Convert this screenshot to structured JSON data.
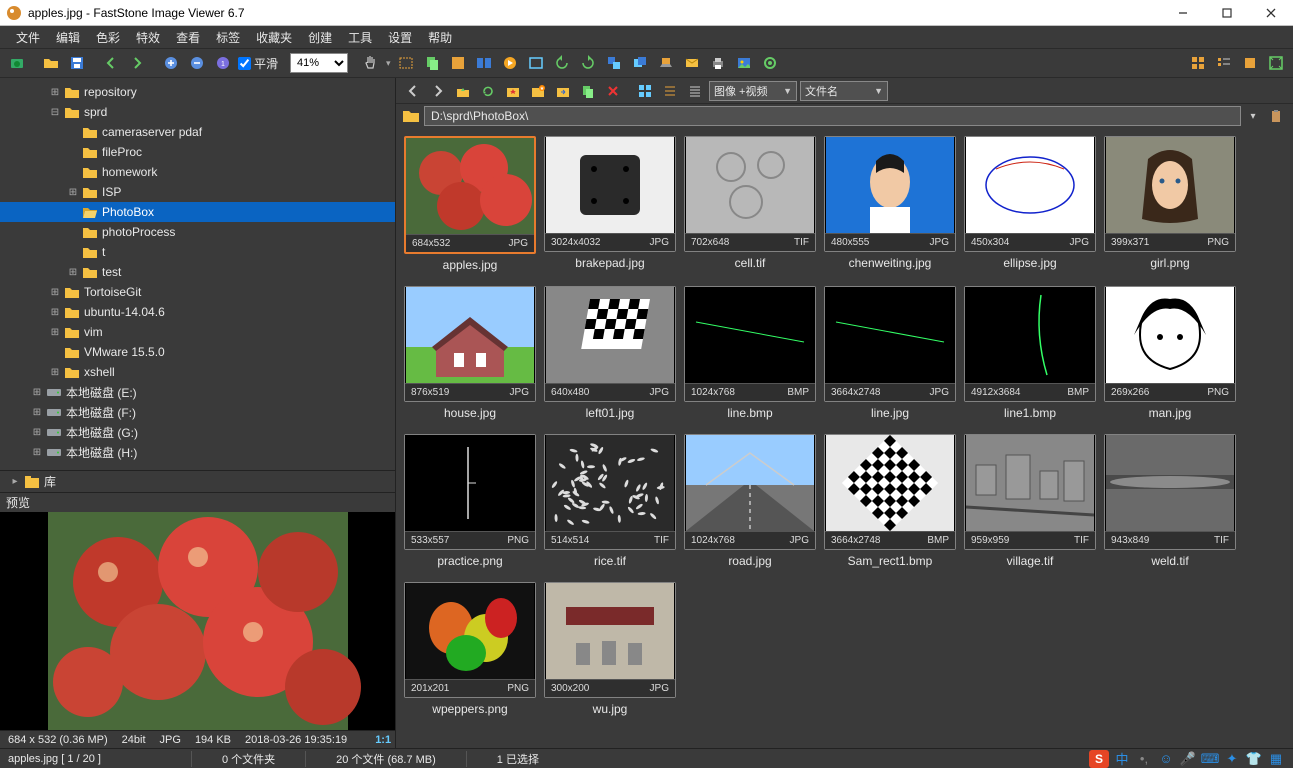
{
  "window": {
    "title": "apples.jpg  -  FastStone Image Viewer 6.7"
  },
  "menu": [
    "文件",
    "编辑",
    "色彩",
    "特效",
    "查看",
    "标签",
    "收藏夹",
    "创建",
    "工具",
    "设置",
    "帮助"
  ],
  "toolbar1": {
    "smooth_label": "平滑",
    "zoom_value": "41%"
  },
  "toolbar2": {
    "filter_label": "图像 +视频",
    "sort_label": "文件名"
  },
  "pathbar": {
    "path": "D:\\sprd\\PhotoBox\\"
  },
  "tree": [
    {
      "indent": 2,
      "twisty": "+",
      "icon": "folder",
      "label": "repository"
    },
    {
      "indent": 2,
      "twisty": "-",
      "icon": "folder",
      "label": "sprd"
    },
    {
      "indent": 3,
      "twisty": "",
      "icon": "folder",
      "label": "cameraserver pdaf"
    },
    {
      "indent": 3,
      "twisty": "",
      "icon": "folder",
      "label": "fileProc"
    },
    {
      "indent": 3,
      "twisty": "",
      "icon": "folder",
      "label": "homework"
    },
    {
      "indent": 3,
      "twisty": "+",
      "icon": "folder",
      "label": "ISP"
    },
    {
      "indent": 3,
      "twisty": "",
      "icon": "folder-open",
      "label": "PhotoBox",
      "selected": true
    },
    {
      "indent": 3,
      "twisty": "",
      "icon": "folder",
      "label": "photoProcess"
    },
    {
      "indent": 3,
      "twisty": "",
      "icon": "folder",
      "label": "t"
    },
    {
      "indent": 3,
      "twisty": "+",
      "icon": "folder",
      "label": "test"
    },
    {
      "indent": 2,
      "twisty": "+",
      "icon": "folder",
      "label": "TortoiseGit"
    },
    {
      "indent": 2,
      "twisty": "+",
      "icon": "folder",
      "label": "ubuntu-14.04.6"
    },
    {
      "indent": 2,
      "twisty": "+",
      "icon": "folder",
      "label": "vim"
    },
    {
      "indent": 2,
      "twisty": "",
      "icon": "folder",
      "label": "VMware 15.5.0"
    },
    {
      "indent": 2,
      "twisty": "+",
      "icon": "folder",
      "label": "xshell"
    },
    {
      "indent": 1,
      "twisty": "+",
      "icon": "drive",
      "label": "本地磁盘 (E:)"
    },
    {
      "indent": 1,
      "twisty": "+",
      "icon": "drive",
      "label": "本地磁盘 (F:)"
    },
    {
      "indent": 1,
      "twisty": "+",
      "icon": "drive",
      "label": "本地磁盘 (G:)"
    },
    {
      "indent": 1,
      "twisty": "+",
      "icon": "drive",
      "label": "本地磁盘 (H:)"
    }
  ],
  "library_row": {
    "label": "库"
  },
  "preview_title": "预览",
  "thumbs": [
    {
      "name": "apples.jpg",
      "dims": "684x532",
      "fmt": "JPG",
      "selected": true,
      "swatch": "apples"
    },
    {
      "name": "brakepad.jpg",
      "dims": "3024x4032",
      "fmt": "JPG",
      "swatch": "brakepad"
    },
    {
      "name": "cell.tif",
      "dims": "702x648",
      "fmt": "TIF",
      "swatch": "cell"
    },
    {
      "name": "chenweiting.jpg",
      "dims": "480x555",
      "fmt": "JPG",
      "swatch": "face"
    },
    {
      "name": "ellipse.jpg",
      "dims": "450x304",
      "fmt": "JPG",
      "swatch": "ellipse"
    },
    {
      "name": "girl.png",
      "dims": "399x371",
      "fmt": "PNG",
      "swatch": "girl"
    },
    {
      "name": "house.jpg",
      "dims": "876x519",
      "fmt": "JPG",
      "swatch": "house"
    },
    {
      "name": "left01.jpg",
      "dims": "640x480",
      "fmt": "JPG",
      "swatch": "checker"
    },
    {
      "name": "line.bmp",
      "dims": "1024x768",
      "fmt": "BMP",
      "swatch": "laser"
    },
    {
      "name": "line.jpg",
      "dims": "3664x2748",
      "fmt": "JPG",
      "swatch": "laser"
    },
    {
      "name": "line1.bmp",
      "dims": "4912x3684",
      "fmt": "BMP",
      "swatch": "laser2"
    },
    {
      "name": "man.jpg",
      "dims": "269x266",
      "fmt": "PNG",
      "swatch": "manga"
    },
    {
      "name": "practice.png",
      "dims": "533x557",
      "fmt": "PNG",
      "swatch": "practice"
    },
    {
      "name": "rice.tif",
      "dims": "514x514",
      "fmt": "TIF",
      "swatch": "rice"
    },
    {
      "name": "road.jpg",
      "dims": "1024x768",
      "fmt": "JPG",
      "swatch": "road"
    },
    {
      "name": "Sam_rect1.bmp",
      "dims": "3664x2748",
      "fmt": "BMP",
      "swatch": "diamond"
    },
    {
      "name": "village.tif",
      "dims": "959x959",
      "fmt": "TIF",
      "swatch": "village"
    },
    {
      "name": "weld.tif",
      "dims": "943x849",
      "fmt": "TIF",
      "swatch": "weld"
    },
    {
      "name": "wpeppers.png",
      "dims": "201x201",
      "fmt": "PNG",
      "swatch": "peppers"
    },
    {
      "name": "wu.jpg",
      "dims": "300x200",
      "fmt": "JPG",
      "swatch": "wu"
    }
  ],
  "status1": {
    "dims": "684 x 532 (0.36 MP)",
    "depth": "24bit",
    "fmt": "JPG",
    "size": "194 KB",
    "date": "2018-03-26 19:35:19",
    "ratio": "1:1"
  },
  "status2": {
    "position": "apples.jpg  [ 1 / 20 ]",
    "folders": "0 个文件夹",
    "files": "20 个文件 (68.7 MB)",
    "selected": "1 已选择"
  },
  "tray_letter": "中"
}
